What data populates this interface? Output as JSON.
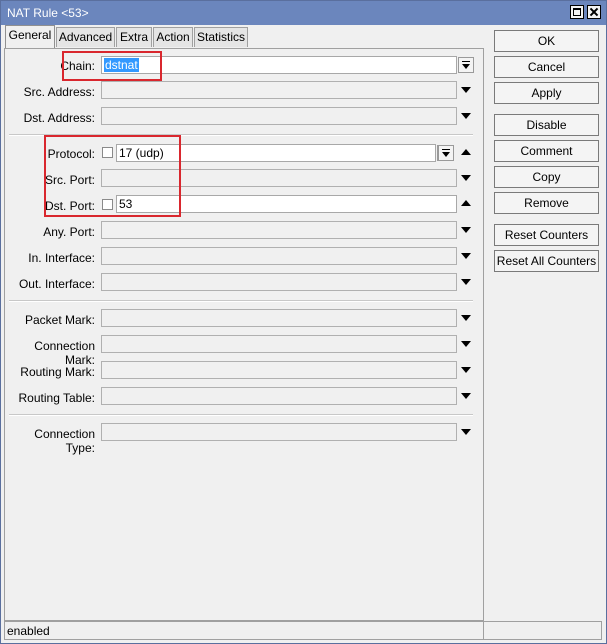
{
  "window": {
    "title": "NAT Rule <53>"
  },
  "tabs": [
    {
      "label": "General"
    },
    {
      "label": "Advanced"
    },
    {
      "label": "Extra"
    },
    {
      "label": "Action"
    },
    {
      "label": "Statistics"
    }
  ],
  "fields": {
    "chain": {
      "label": "Chain:",
      "value": "dstnat"
    },
    "src_address": {
      "label": "Src. Address:",
      "value": ""
    },
    "dst_address": {
      "label": "Dst. Address:",
      "value": ""
    },
    "protocol": {
      "label": "Protocol:",
      "value": "17 (udp)"
    },
    "src_port": {
      "label": "Src. Port:",
      "value": ""
    },
    "dst_port": {
      "label": "Dst. Port:",
      "value": "53"
    },
    "any_port": {
      "label": "Any. Port:",
      "value": ""
    },
    "in_interface": {
      "label": "In. Interface:",
      "value": ""
    },
    "out_interface": {
      "label": "Out. Interface:",
      "value": ""
    },
    "packet_mark": {
      "label": "Packet Mark:",
      "value": ""
    },
    "connection_mark": {
      "label": "Connection Mark:",
      "value": ""
    },
    "routing_mark": {
      "label": "Routing Mark:",
      "value": ""
    },
    "routing_table": {
      "label": "Routing Table:",
      "value": ""
    },
    "connection_type": {
      "label": "Connection Type:",
      "value": ""
    }
  },
  "buttons": {
    "ok": "OK",
    "cancel": "Cancel",
    "apply": "Apply",
    "disable": "Disable",
    "comment": "Comment",
    "copy": "Copy",
    "remove": "Remove",
    "reset_counters": "Reset Counters",
    "reset_all_counters": "Reset All Counters"
  },
  "status": {
    "text": "enabled"
  },
  "highlight_color": "#d9272e"
}
